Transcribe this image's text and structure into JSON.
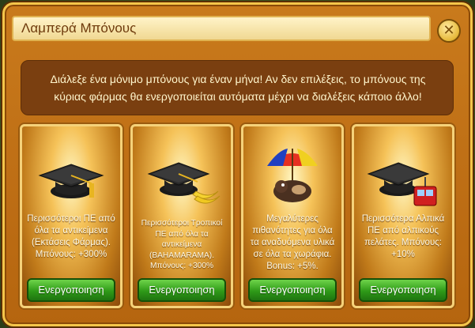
{
  "dialog": {
    "title": "Λαμπερά Μπόνους",
    "description": "Διάλεξε ένα μόνιμο μπόνους για έναν μήνα! Αν δεν επιλέξεις, το μπόνους της κύριας φάρμας θα ενεργοποιείται αυτόματα μέχρι να διαλέξεις κάποιο άλλο!"
  },
  "cards": [
    {
      "icon": "graduation-cap-icon",
      "text": "Περισσότεροι ΠΕ από όλα τα αντικείμενα (Εκτάσεις Φάρμας). Μπόνους: +300%",
      "button": "Ενεργοποιηση"
    },
    {
      "icon": "graduation-cap-bananas-icon",
      "text": "Περισσότεροι Τροπικοί ΠΕ από όλα τα αντικείμενα (BAHAMARAMA). Μπόνους: +300%",
      "button": "Ενεργοποιηση"
    },
    {
      "icon": "mouse-umbrella-icon",
      "text": "Μεγαλύτερες πιθανότητες για όλα τα αναδυόμενα υλικά σε όλα τα χωράφια. Bonus: +5%.",
      "button": "Ενεργοποιηση"
    },
    {
      "icon": "graduation-cap-gondola-icon",
      "text": "Περισσότερα Αλπικά ΠΕ από αλπικούς πελάτες. Μπόνους: +10%",
      "button": "Ενεργοποιηση"
    }
  ],
  "colors": {
    "button_green": "#2f9a18",
    "frame_orange": "#c97a1c",
    "title_text": "#6e3a0c"
  }
}
